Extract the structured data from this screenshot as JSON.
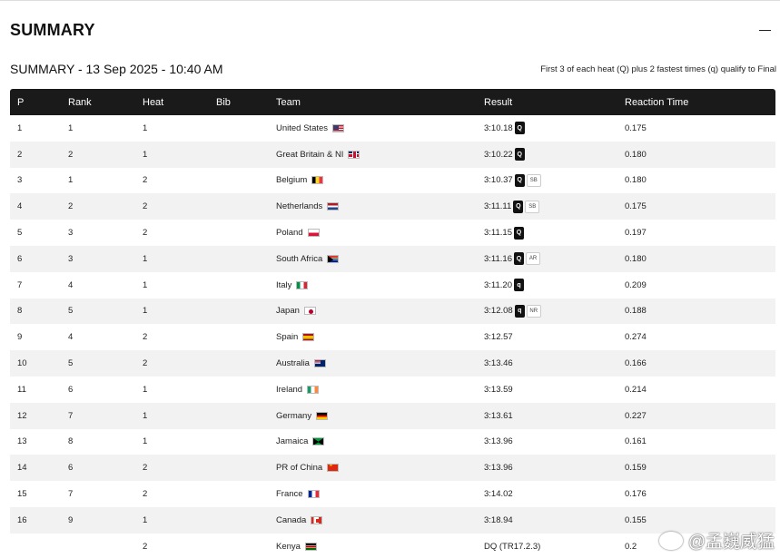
{
  "panel": {
    "title": "SUMMARY"
  },
  "summary": {
    "subtitle": "SUMMARY - 13 Sep 2025 - 10:40 AM",
    "note": "First 3 of each heat (Q) plus 2 fastest times (q) qualify to Final"
  },
  "table": {
    "headers": {
      "p": "P",
      "rank": "Rank",
      "heat": "Heat",
      "bib": "Bib",
      "team": "Team",
      "result": "Result",
      "rt": "Reaction Time"
    },
    "rows": [
      {
        "p": "1",
        "rank": "1",
        "heat": "1",
        "bib": "",
        "team": "United States",
        "flag": "us",
        "result": "3:10.18",
        "q": "Q",
        "rec": "",
        "rt": "0.175"
      },
      {
        "p": "2",
        "rank": "2",
        "heat": "1",
        "bib": "",
        "team": "Great Britain & NI",
        "flag": "gb",
        "result": "3:10.22",
        "q": "Q",
        "rec": "",
        "rt": "0.180"
      },
      {
        "p": "3",
        "rank": "1",
        "heat": "2",
        "bib": "",
        "team": "Belgium",
        "flag": "be",
        "result": "3:10.37",
        "q": "Q",
        "rec": "SB",
        "rt": "0.180"
      },
      {
        "p": "4",
        "rank": "2",
        "heat": "2",
        "bib": "",
        "team": "Netherlands",
        "flag": "nl",
        "result": "3:11.11",
        "q": "Q",
        "rec": "SB",
        "rt": "0.175"
      },
      {
        "p": "5",
        "rank": "3",
        "heat": "2",
        "bib": "",
        "team": "Poland",
        "flag": "pl",
        "result": "3:11.15",
        "q": "Q",
        "rec": "",
        "rt": "0.197"
      },
      {
        "p": "6",
        "rank": "3",
        "heat": "1",
        "bib": "",
        "team": "South Africa",
        "flag": "za",
        "result": "3:11.16",
        "q": "Q",
        "rec": "AR",
        "rt": "0.180"
      },
      {
        "p": "7",
        "rank": "4",
        "heat": "1",
        "bib": "",
        "team": "Italy",
        "flag": "it",
        "result": "3:11.20",
        "q": "q",
        "rec": "",
        "rt": "0.209"
      },
      {
        "p": "8",
        "rank": "5",
        "heat": "1",
        "bib": "",
        "team": "Japan",
        "flag": "jp",
        "result": "3:12.08",
        "q": "q",
        "rec": "NR",
        "rt": "0.188"
      },
      {
        "p": "9",
        "rank": "4",
        "heat": "2",
        "bib": "",
        "team": "Spain",
        "flag": "es",
        "result": "3:12.57",
        "q": "",
        "rec": "",
        "rt": "0.274"
      },
      {
        "p": "10",
        "rank": "5",
        "heat": "2",
        "bib": "",
        "team": "Australia",
        "flag": "au",
        "result": "3:13.46",
        "q": "",
        "rec": "",
        "rt": "0.166"
      },
      {
        "p": "11",
        "rank": "6",
        "heat": "1",
        "bib": "",
        "team": "Ireland",
        "flag": "ie",
        "result": "3:13.59",
        "q": "",
        "rec": "",
        "rt": "0.214"
      },
      {
        "p": "12",
        "rank": "7",
        "heat": "1",
        "bib": "",
        "team": "Germany",
        "flag": "de",
        "result": "3:13.61",
        "q": "",
        "rec": "",
        "rt": "0.227"
      },
      {
        "p": "13",
        "rank": "8",
        "heat": "1",
        "bib": "",
        "team": "Jamaica",
        "flag": "jm",
        "result": "3:13.96",
        "q": "",
        "rec": "",
        "rt": "0.161"
      },
      {
        "p": "14",
        "rank": "6",
        "heat": "2",
        "bib": "",
        "team": "PR of China",
        "flag": "cn",
        "result": "3:13.96",
        "q": "",
        "rec": "",
        "rt": "0.159"
      },
      {
        "p": "15",
        "rank": "7",
        "heat": "2",
        "bib": "",
        "team": "France",
        "flag": "fr",
        "result": "3:14.02",
        "q": "",
        "rec": "",
        "rt": "0.176"
      },
      {
        "p": "16",
        "rank": "9",
        "heat": "1",
        "bib": "",
        "team": "Canada",
        "flag": "ca",
        "result": "3:18.94",
        "q": "",
        "rec": "",
        "rt": "0.155"
      },
      {
        "p": "",
        "rank": "",
        "heat": "2",
        "bib": "",
        "team": "Kenya",
        "flag": "ke",
        "result": "DQ (TR17.2.3)",
        "q": "",
        "rec": "",
        "rt": "0.2"
      }
    ]
  },
  "watermark": {
    "text": "@孟巍威猛"
  }
}
